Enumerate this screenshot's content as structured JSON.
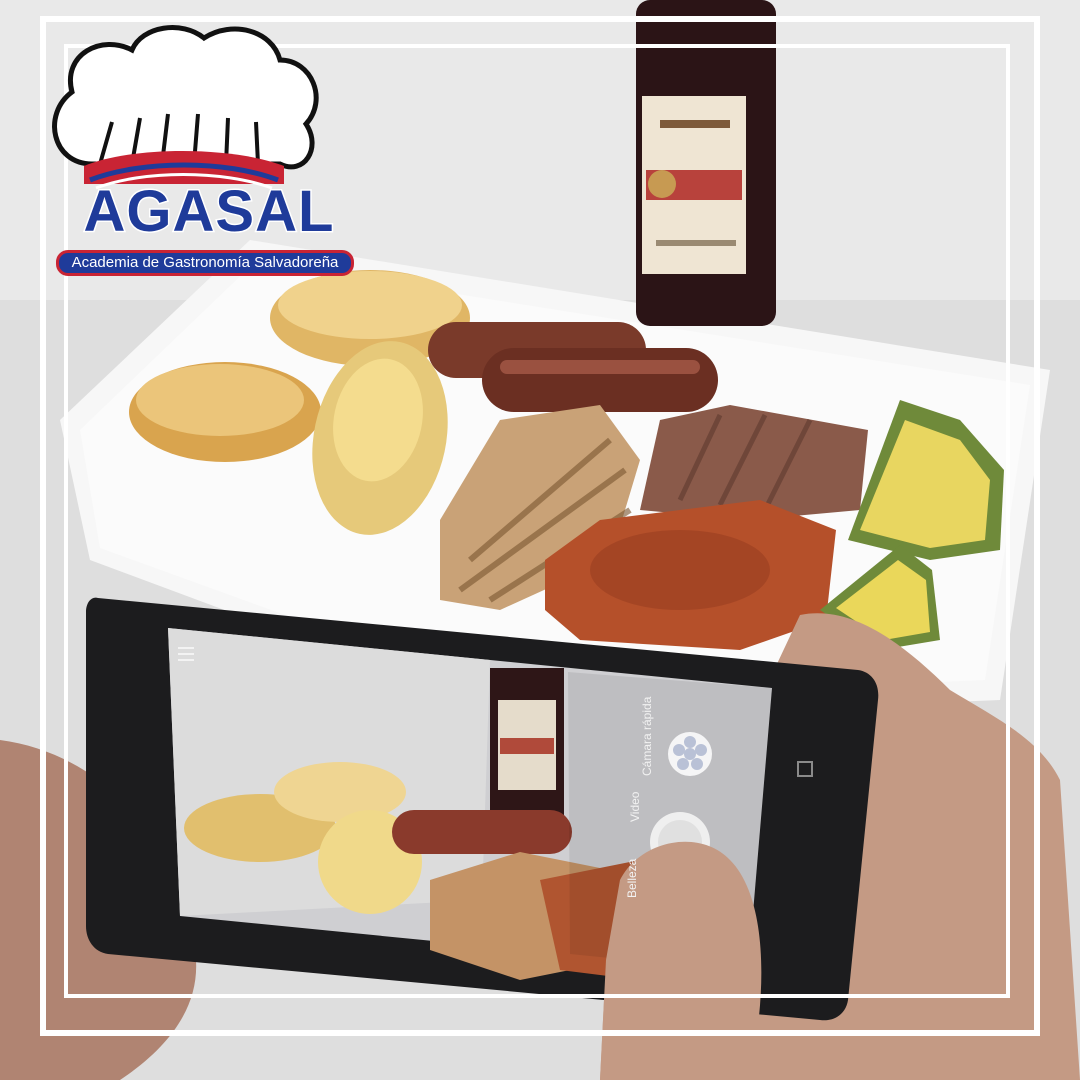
{
  "logo": {
    "brand": "AGASAL",
    "tagline": "Academia de Gastronomía Salvadoreña",
    "colors": {
      "primary": "#1f3b9a",
      "accent": "#c92434",
      "outline": "#ffffff"
    }
  },
  "phone_screen": {
    "mode_labels": {
      "quick_camera": "Cámara rápida",
      "video": "Video",
      "beauty": "Belleza"
    },
    "icons": [
      "menu-icon",
      "flower-filter-icon",
      "shutter-icon",
      "square-nav-icon"
    ]
  },
  "frame": {
    "color": "#ffffff"
  }
}
